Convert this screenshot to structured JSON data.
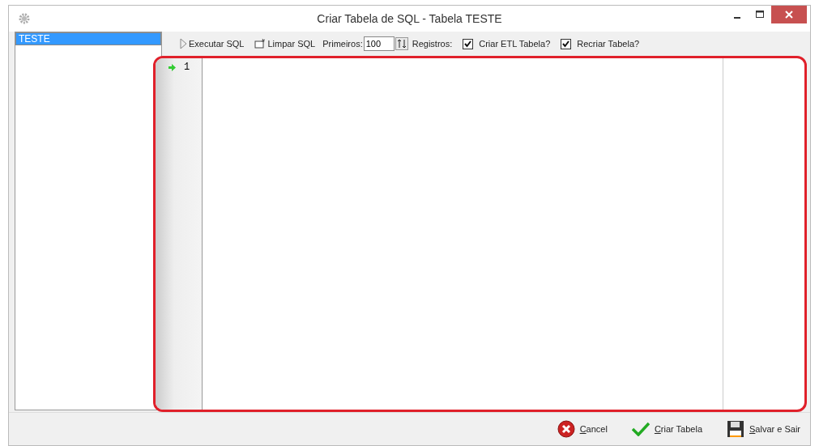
{
  "window": {
    "title": "Criar Tabela de SQL - Tabela TESTE"
  },
  "tables": [
    {
      "label": "TESTE",
      "selected": true
    }
  ],
  "toolbar": {
    "execute": "Executar SQL",
    "clear": "Limpar SQL",
    "first_label": "Primeiros:",
    "first_value": "100",
    "records_label": "Registros:",
    "checkboxes": [
      {
        "label": "Criar ETL Tabela?",
        "checked": true
      },
      {
        "label": "Recriar Tabela?",
        "checked": true
      }
    ]
  },
  "editor": {
    "lines": [
      {
        "number": "1",
        "current": true
      }
    ]
  },
  "buttons": [
    {
      "kind": "cancel",
      "label": "Cancel"
    },
    {
      "kind": "create",
      "label": "Criar Tabela"
    },
    {
      "kind": "save",
      "label": "Salvar e Sair"
    }
  ]
}
